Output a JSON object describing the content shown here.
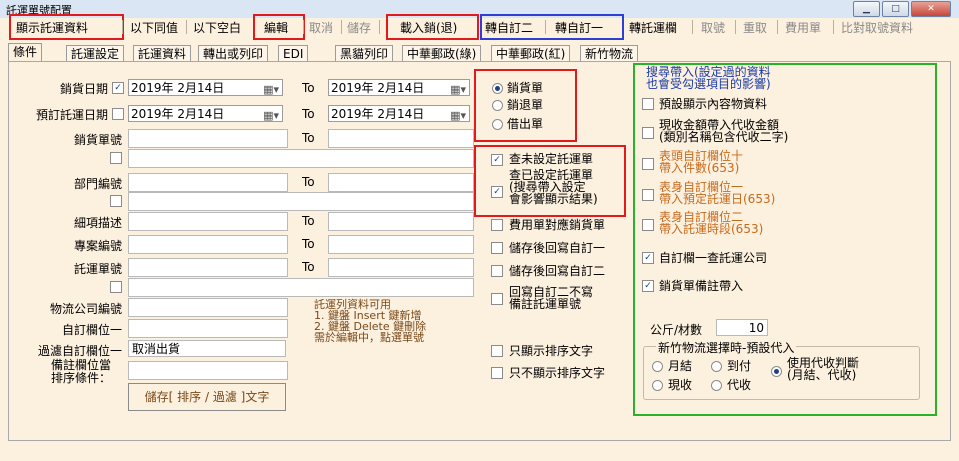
{
  "window": {
    "title": "託運單號配置",
    "min": "▁",
    "max": "□",
    "close": "✕"
  },
  "toolbar": {
    "show_shipment": "顯示託運資料",
    "same_below": "以下同值",
    "blank_below": "以下空白",
    "edit": "編輯",
    "cancel": "取消",
    "save": "儲存",
    "load_pin_return": "載入銷(退)",
    "to_custom2": "轉自訂二",
    "to_custom1": "轉自訂一",
    "to_shipment_field": "轉託運欄",
    "cancel_sale": "取號",
    "retake": "重取",
    "expense": "費用單",
    "compare": "比對取號資料"
  },
  "tabs": [
    "條件",
    "託運設定",
    "託運資料",
    "轉出或列印",
    "EDI",
    "黑貓列印",
    "中華郵政(綠)",
    "中華郵政(紅)",
    "新竹物流"
  ],
  "form": {
    "sales_date": "銷貨日期",
    "order_date": "預訂託運日期",
    "sales_no": "銷貨單號",
    "dept_no": "部門編號",
    "item_desc": "細項描述",
    "project_no": "專案編號",
    "ship_no": "託運單號",
    "logistics_no": "物流公司編號",
    "custom_field1": "自訂欄位一",
    "filter_custom1": "過濾自訂欄位一",
    "filter_custom1_value": "取消出貨",
    "remark_sort": "備註欄位當\n排序條件：",
    "to": "To",
    "date_from1": "2019年  2月14日",
    "date_to1": "2019年  2月14日",
    "date_from2": "2019年  2月14日",
    "date_to2": "2019年  2月14日",
    "note_line1": "託運列資料可用",
    "note_line2": "1. 鍵盤 Insert 鍵新增",
    "note_line3": "2. 鍵盤 Delete 鍵刪除",
    "note_line4": "需於編輯中，點選單號",
    "save_sort_filter": "儲存[ 排序 / 過濾 ]文字"
  },
  "doc_type": {
    "sales": "銷貨單",
    "return": "銷退單",
    "lend": "借出單"
  },
  "options": {
    "query_unset": "查未設定託運單",
    "query_set": "查已設定託運單\n(搜尋帶入設定\n會影響顯示結果)",
    "expense_match": "費用單對應銷貨單",
    "write_custom1": "儲存後回寫自訂一",
    "write_custom2": "儲存後回寫自訂二",
    "write_custom2_no": "回寫自訂二不寫\n備註託運單號",
    "only_sort": "只顯示排序文字",
    "no_sort": "只不顯示排序文字"
  },
  "search_fill": {
    "title": "搜尋帶入(設定過的資料\n也會受勾選項目的影響)",
    "preset_content": "預設顯示內容物資料",
    "cash_amount": "現收金額帶入代收金額\n(類別名稱包含代收二字)",
    "header_custom10": "表頭自訂欄位十\n帶入件數(653)",
    "body_custom1": "表身自訂欄位一\n帶入預定託運日(653)",
    "body_custom2": "表身自訂欄位二\n帶入託運時段(653)",
    "custom1_query": "自訂欄一查託運公司",
    "sales_remark": "銷貨單備註帶入",
    "kg_per_cuft": "公斤/材數",
    "kg_value": "10",
    "hsinchu_title": "新竹物流選擇時-預設代入",
    "monthly": "月結",
    "cod": "到付",
    "use_collect": "使用代收判斷\n(月結、代收)",
    "cash": "現收",
    "collect": "代收"
  }
}
